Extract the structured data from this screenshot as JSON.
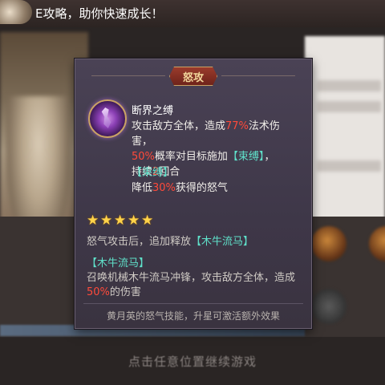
{
  "banner": {
    "text": "E攻略，助你快速成长！"
  },
  "bottom_hint": "点击任意位置继续游戏",
  "tooltip": {
    "tag": "怒攻",
    "skill_name": "断界之缚",
    "desc_1": "攻击敌方全体，造成",
    "desc_pct": "77%",
    "desc_2": "法术伤害，",
    "desc_chance": "50%",
    "desc_3": "概率对目标施加",
    "desc_bind": "【束缚】",
    "desc_4": "，",
    "desc_5": "持续",
    "desc_turns": "2",
    "desc_6": "回合",
    "effect_name": "【束缚】",
    "effect_1": "降低",
    "effect_pct": "30%",
    "effect_2": "获得的怒气",
    "stars": "★★★★★",
    "star_count": 5,
    "bonus_1": "怒气攻击后，追加释放",
    "bonus_skill": "【木牛流马】",
    "bonus_name": "【木牛流马】",
    "bonus_desc_1": "召唤机械木牛流马冲锋，攻击敌方全体，造成",
    "bonus_pct": "50%",
    "bonus_desc_2": "的伤害",
    "footer": "黄月英的怒气技能，升星可激活额外效果"
  },
  "colors": {
    "highlight_red": "#ff4a3a",
    "highlight_teal": "#5fe0c9",
    "star_gold": "#ffd34a",
    "tag_bg": "#9a3b2c"
  }
}
